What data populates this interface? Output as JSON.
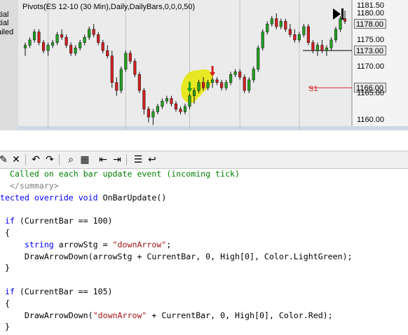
{
  "chart": {
    "title": "Pivots(ES 12-10 (30 Min),Daily,DailyBars,0,0,0,50)",
    "price_axis": [
      {
        "value": "1181.50",
        "boxed": false
      },
      {
        "value": "1180.00",
        "boxed": false
      },
      {
        "value": "1178.00",
        "boxed": true
      },
      {
        "value": "1175.00",
        "boxed": false
      },
      {
        "value": "1173.00",
        "boxed": true
      },
      {
        "value": "1170.00",
        "boxed": false
      },
      {
        "value": "1166.00",
        "boxed": true
      },
      {
        "value": "1165.00",
        "boxed": false
      },
      {
        "value": "1160.00",
        "boxed": false
      }
    ],
    "pivot_label": "S1",
    "pivot_price": 1166.0,
    "upper_pivot_price": 1173.0,
    "colors": {
      "up_bar": "#22a022",
      "down_bar": "#d22020",
      "pivot_line": "#e0282a",
      "highlight": "#e6e600"
    },
    "bars": [
      {
        "o": 1173.5,
        "h": 1174.5,
        "l": 1172,
        "c": 1174
      },
      {
        "o": 1174,
        "h": 1175.5,
        "l": 1173.5,
        "c": 1175
      },
      {
        "o": 1175,
        "h": 1177,
        "l": 1174.5,
        "c": 1176.5
      },
      {
        "o": 1176.5,
        "h": 1177,
        "l": 1174,
        "c": 1174.5
      },
      {
        "o": 1174.5,
        "h": 1175,
        "l": 1172.5,
        "c": 1173
      },
      {
        "o": 1173,
        "h": 1174.5,
        "l": 1172,
        "c": 1174
      },
      {
        "o": 1174,
        "h": 1175,
        "l": 1173.5,
        "c": 1174.5
      },
      {
        "o": 1174.5,
        "h": 1176.5,
        "l": 1174,
        "c": 1176
      },
      {
        "o": 1176,
        "h": 1177,
        "l": 1175,
        "c": 1175.5
      },
      {
        "o": 1175.5,
        "h": 1176,
        "l": 1173.5,
        "c": 1174
      },
      {
        "o": 1174,
        "h": 1174.5,
        "l": 1172,
        "c": 1172.5
      },
      {
        "o": 1172.5,
        "h": 1174,
        "l": 1172,
        "c": 1173.5
      },
      {
        "o": 1173.5,
        "h": 1175,
        "l": 1173,
        "c": 1174.5
      },
      {
        "o": 1174.5,
        "h": 1176,
        "l": 1174,
        "c": 1175.5
      },
      {
        "o": 1175.5,
        "h": 1177.5,
        "l": 1175,
        "c": 1177
      },
      {
        "o": 1177,
        "h": 1178,
        "l": 1175.5,
        "c": 1176
      },
      {
        "o": 1176,
        "h": 1176.5,
        "l": 1174,
        "c": 1174.5
      },
      {
        "o": 1174.5,
        "h": 1175,
        "l": 1172.5,
        "c": 1173
      },
      {
        "o": 1173,
        "h": 1174,
        "l": 1171.5,
        "c": 1172
      },
      {
        "o": 1172,
        "h": 1173,
        "l": 1166,
        "c": 1167
      },
      {
        "o": 1167,
        "h": 1168,
        "l": 1164.5,
        "c": 1165.5
      },
      {
        "o": 1165.5,
        "h": 1170,
        "l": 1165,
        "c": 1169.5
      },
      {
        "o": 1169.5,
        "h": 1173,
        "l": 1169,
        "c": 1172.5
      },
      {
        "o": 1172.5,
        "h": 1173,
        "l": 1170.5,
        "c": 1171
      },
      {
        "o": 1171,
        "h": 1171.5,
        "l": 1168,
        "c": 1168.5
      },
      {
        "o": 1168.5,
        "h": 1169,
        "l": 1165,
        "c": 1165.5
      },
      {
        "o": 1165.5,
        "h": 1166,
        "l": 1161,
        "c": 1162
      },
      {
        "o": 1162,
        "h": 1162.5,
        "l": 1159.5,
        "c": 1160.5
      },
      {
        "o": 1160.5,
        "h": 1162,
        "l": 1159,
        "c": 1161.5
      },
      {
        "o": 1161.5,
        "h": 1163,
        "l": 1161,
        "c": 1162.5
      },
      {
        "o": 1162.5,
        "h": 1164,
        "l": 1162,
        "c": 1163.5
      },
      {
        "o": 1163.5,
        "h": 1164.5,
        "l": 1163,
        "c": 1164
      },
      {
        "o": 1164,
        "h": 1164.5,
        "l": 1162.5,
        "c": 1163
      },
      {
        "o": 1163,
        "h": 1163.5,
        "l": 1161.5,
        "c": 1162
      },
      {
        "o": 1162,
        "h": 1162.5,
        "l": 1161,
        "c": 1161.5
      },
      {
        "o": 1161.5,
        "h": 1163,
        "l": 1161,
        "c": 1162.5
      },
      {
        "o": 1162.5,
        "h": 1165,
        "l": 1162,
        "c": 1164.5
      },
      {
        "o": 1164.5,
        "h": 1166,
        "l": 1163,
        "c": 1165.5
      },
      {
        "o": 1165.5,
        "h": 1167.5,
        "l": 1165,
        "c": 1167
      },
      {
        "o": 1167,
        "h": 1168,
        "l": 1165.5,
        "c": 1166
      },
      {
        "o": 1166,
        "h": 1167.5,
        "l": 1165.5,
        "c": 1167
      },
      {
        "o": 1167,
        "h": 1168,
        "l": 1166,
        "c": 1167.5
      },
      {
        "o": 1167.5,
        "h": 1168,
        "l": 1166.5,
        "c": 1167
      },
      {
        "o": 1167,
        "h": 1167.5,
        "l": 1165.5,
        "c": 1166
      },
      {
        "o": 1166,
        "h": 1167.5,
        "l": 1165.5,
        "c": 1167
      },
      {
        "o": 1167,
        "h": 1169,
        "l": 1166.5,
        "c": 1168.5
      },
      {
        "o": 1168.5,
        "h": 1169.5,
        "l": 1168,
        "c": 1169
      },
      {
        "o": 1169,
        "h": 1169.5,
        "l": 1167.5,
        "c": 1168
      },
      {
        "o": 1168,
        "h": 1168.5,
        "l": 1165,
        "c": 1165.5
      },
      {
        "o": 1165.5,
        "h": 1168,
        "l": 1165,
        "c": 1167.5
      },
      {
        "o": 1167.5,
        "h": 1170,
        "l": 1167,
        "c": 1169.5
      },
      {
        "o": 1169.5,
        "h": 1174,
        "l": 1169,
        "c": 1173.5
      },
      {
        "o": 1173.5,
        "h": 1177,
        "l": 1173,
        "c": 1176.5
      },
      {
        "o": 1176.5,
        "h": 1178.5,
        "l": 1176,
        "c": 1178
      },
      {
        "o": 1178,
        "h": 1179.5,
        "l": 1177.5,
        "c": 1179
      },
      {
        "o": 1179,
        "h": 1180,
        "l": 1177,
        "c": 1177.5
      },
      {
        "o": 1177.5,
        "h": 1179,
        "l": 1177,
        "c": 1178.5
      },
      {
        "o": 1178.5,
        "h": 1179,
        "l": 1176.5,
        "c": 1177
      },
      {
        "o": 1177,
        "h": 1178,
        "l": 1175.5,
        "c": 1176
      },
      {
        "o": 1176,
        "h": 1177,
        "l": 1174.5,
        "c": 1175
      },
      {
        "o": 1175,
        "h": 1176.5,
        "l": 1174.5,
        "c": 1176
      },
      {
        "o": 1176,
        "h": 1178,
        "l": 1175.5,
        "c": 1177.5
      },
      {
        "o": 1177.5,
        "h": 1178,
        "l": 1174,
        "c": 1174.5
      },
      {
        "o": 1174.5,
        "h": 1175,
        "l": 1172.5,
        "c": 1173
      },
      {
        "o": 1173,
        "h": 1174.5,
        "l": 1172,
        "c": 1174
      },
      {
        "o": 1174,
        "h": 1175,
        "l": 1172.5,
        "c": 1173
      },
      {
        "o": 1173,
        "h": 1174,
        "l": 1172,
        "c": 1173.5
      },
      {
        "o": 1173.5,
        "h": 1175.5,
        "l": 1173,
        "c": 1175
      },
      {
        "o": 1175,
        "h": 1177.5,
        "l": 1174.5,
        "c": 1177
      },
      {
        "o": 1177,
        "h": 1179.5,
        "l": 1176.5,
        "c": 1179
      },
      {
        "o": 1179,
        "h": 1180.5,
        "l": 1178,
        "c": 1178.5
      }
    ],
    "arrow_bars": [
      {
        "bar_index": 36,
        "color": "#22a022"
      },
      {
        "bar_index": 41,
        "color": "#d22020"
      }
    ]
  },
  "left_panel": {
    "lines": [
      "itial",
      "itial",
      "ailed"
    ]
  },
  "toolbar": {
    "buttons": [
      {
        "name": "toolbar-button-1",
        "glyph": "✎"
      },
      {
        "name": "delete-button",
        "glyph": "✕"
      },
      {
        "name": "undo-button",
        "glyph": "↶"
      },
      {
        "name": "redo-button",
        "glyph": "↷"
      },
      {
        "name": "find-button",
        "glyph": "⌕"
      },
      {
        "name": "grid-button",
        "glyph": "▦"
      },
      {
        "name": "indent-button",
        "glyph": "⇤"
      },
      {
        "name": "outdent-button",
        "glyph": "⇥"
      },
      {
        "name": "list-button",
        "glyph": "☰"
      },
      {
        "name": "wrap-button",
        "glyph": "↩"
      }
    ]
  },
  "code": {
    "lines": [
      [
        {
          "t": "  Called on each bar update event (incoming tick)",
          "c": "cmt"
        }
      ],
      [
        {
          "t": "  </summary>",
          "c": "gray"
        }
      ],
      [
        {
          "t": "tected ",
          "c": "kw"
        },
        {
          "t": "override ",
          "c": "kw"
        },
        {
          "t": "void ",
          "c": "kw"
        },
        {
          "t": "OnBarUpdate()",
          "c": ""
        }
      ],
      [
        {
          "t": "",
          "c": ""
        }
      ],
      [
        {
          "t": " if ",
          "c": "kw"
        },
        {
          "t": "(CurrentBar == 100)",
          "c": ""
        }
      ],
      [
        {
          "t": " {",
          "c": ""
        }
      ],
      [
        {
          "t": "     string ",
          "c": "kw"
        },
        {
          "t": "arrowStg = ",
          "c": ""
        },
        {
          "t": "\"downArrow\"",
          "c": "str"
        },
        {
          "t": ";",
          "c": ""
        }
      ],
      [
        {
          "t": "     DrawArrowDown(arrowStg + CurrentBar, 0, High[0], Color.LightGreen);",
          "c": ""
        }
      ],
      [
        {
          "t": " }",
          "c": ""
        }
      ],
      [
        {
          "t": "",
          "c": ""
        }
      ],
      [
        {
          "t": " if ",
          "c": "kw"
        },
        {
          "t": "(CurrentBar == 105)",
          "c": ""
        }
      ],
      [
        {
          "t": " {",
          "c": ""
        }
      ],
      [
        {
          "t": "     DrawArrowDown(",
          "c": ""
        },
        {
          "t": "\"downArrow\"",
          "c": "str"
        },
        {
          "t": " + CurrentBar, 0, High[0], Color.Red);",
          "c": ""
        }
      ],
      [
        {
          "t": " }",
          "c": ""
        }
      ]
    ]
  }
}
